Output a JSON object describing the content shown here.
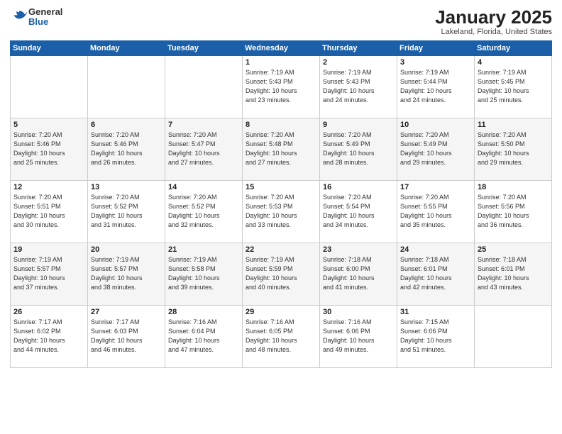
{
  "logo": {
    "general": "General",
    "blue": "Blue"
  },
  "title": "January 2025",
  "location": "Lakeland, Florida, United States",
  "days_of_week": [
    "Sunday",
    "Monday",
    "Tuesday",
    "Wednesday",
    "Thursday",
    "Friday",
    "Saturday"
  ],
  "weeks": [
    [
      {
        "day": "",
        "info": ""
      },
      {
        "day": "",
        "info": ""
      },
      {
        "day": "",
        "info": ""
      },
      {
        "day": "1",
        "info": "Sunrise: 7:19 AM\nSunset: 5:43 PM\nDaylight: 10 hours\nand 23 minutes."
      },
      {
        "day": "2",
        "info": "Sunrise: 7:19 AM\nSunset: 5:43 PM\nDaylight: 10 hours\nand 24 minutes."
      },
      {
        "day": "3",
        "info": "Sunrise: 7:19 AM\nSunset: 5:44 PM\nDaylight: 10 hours\nand 24 minutes."
      },
      {
        "day": "4",
        "info": "Sunrise: 7:19 AM\nSunset: 5:45 PM\nDaylight: 10 hours\nand 25 minutes."
      }
    ],
    [
      {
        "day": "5",
        "info": "Sunrise: 7:20 AM\nSunset: 5:46 PM\nDaylight: 10 hours\nand 25 minutes."
      },
      {
        "day": "6",
        "info": "Sunrise: 7:20 AM\nSunset: 5:46 PM\nDaylight: 10 hours\nand 26 minutes."
      },
      {
        "day": "7",
        "info": "Sunrise: 7:20 AM\nSunset: 5:47 PM\nDaylight: 10 hours\nand 27 minutes."
      },
      {
        "day": "8",
        "info": "Sunrise: 7:20 AM\nSunset: 5:48 PM\nDaylight: 10 hours\nand 27 minutes."
      },
      {
        "day": "9",
        "info": "Sunrise: 7:20 AM\nSunset: 5:49 PM\nDaylight: 10 hours\nand 28 minutes."
      },
      {
        "day": "10",
        "info": "Sunrise: 7:20 AM\nSunset: 5:49 PM\nDaylight: 10 hours\nand 29 minutes."
      },
      {
        "day": "11",
        "info": "Sunrise: 7:20 AM\nSunset: 5:50 PM\nDaylight: 10 hours\nand 29 minutes."
      }
    ],
    [
      {
        "day": "12",
        "info": "Sunrise: 7:20 AM\nSunset: 5:51 PM\nDaylight: 10 hours\nand 30 minutes."
      },
      {
        "day": "13",
        "info": "Sunrise: 7:20 AM\nSunset: 5:52 PM\nDaylight: 10 hours\nand 31 minutes."
      },
      {
        "day": "14",
        "info": "Sunrise: 7:20 AM\nSunset: 5:52 PM\nDaylight: 10 hours\nand 32 minutes."
      },
      {
        "day": "15",
        "info": "Sunrise: 7:20 AM\nSunset: 5:53 PM\nDaylight: 10 hours\nand 33 minutes."
      },
      {
        "day": "16",
        "info": "Sunrise: 7:20 AM\nSunset: 5:54 PM\nDaylight: 10 hours\nand 34 minutes."
      },
      {
        "day": "17",
        "info": "Sunrise: 7:20 AM\nSunset: 5:55 PM\nDaylight: 10 hours\nand 35 minutes."
      },
      {
        "day": "18",
        "info": "Sunrise: 7:20 AM\nSunset: 5:56 PM\nDaylight: 10 hours\nand 36 minutes."
      }
    ],
    [
      {
        "day": "19",
        "info": "Sunrise: 7:19 AM\nSunset: 5:57 PM\nDaylight: 10 hours\nand 37 minutes."
      },
      {
        "day": "20",
        "info": "Sunrise: 7:19 AM\nSunset: 5:57 PM\nDaylight: 10 hours\nand 38 minutes."
      },
      {
        "day": "21",
        "info": "Sunrise: 7:19 AM\nSunset: 5:58 PM\nDaylight: 10 hours\nand 39 minutes."
      },
      {
        "day": "22",
        "info": "Sunrise: 7:19 AM\nSunset: 5:59 PM\nDaylight: 10 hours\nand 40 minutes."
      },
      {
        "day": "23",
        "info": "Sunrise: 7:18 AM\nSunset: 6:00 PM\nDaylight: 10 hours\nand 41 minutes."
      },
      {
        "day": "24",
        "info": "Sunrise: 7:18 AM\nSunset: 6:01 PM\nDaylight: 10 hours\nand 42 minutes."
      },
      {
        "day": "25",
        "info": "Sunrise: 7:18 AM\nSunset: 6:01 PM\nDaylight: 10 hours\nand 43 minutes."
      }
    ],
    [
      {
        "day": "26",
        "info": "Sunrise: 7:17 AM\nSunset: 6:02 PM\nDaylight: 10 hours\nand 44 minutes."
      },
      {
        "day": "27",
        "info": "Sunrise: 7:17 AM\nSunset: 6:03 PM\nDaylight: 10 hours\nand 46 minutes."
      },
      {
        "day": "28",
        "info": "Sunrise: 7:16 AM\nSunset: 6:04 PM\nDaylight: 10 hours\nand 47 minutes."
      },
      {
        "day": "29",
        "info": "Sunrise: 7:16 AM\nSunset: 6:05 PM\nDaylight: 10 hours\nand 48 minutes."
      },
      {
        "day": "30",
        "info": "Sunrise: 7:16 AM\nSunset: 6:06 PM\nDaylight: 10 hours\nand 49 minutes."
      },
      {
        "day": "31",
        "info": "Sunrise: 7:15 AM\nSunset: 6:06 PM\nDaylight: 10 hours\nand 51 minutes."
      },
      {
        "day": "",
        "info": ""
      }
    ]
  ]
}
